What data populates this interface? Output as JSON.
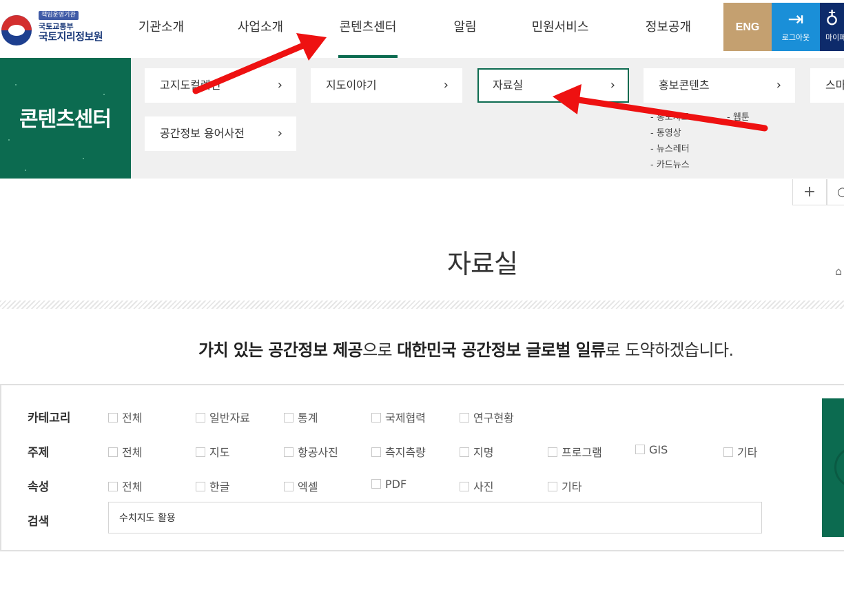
{
  "logo": {
    "badge": "책임운영기관",
    "sub": "국토교통부",
    "main": "국토지리정보원"
  },
  "gnb": [
    {
      "label": "기관소개",
      "active": false
    },
    {
      "label": "사업소개",
      "active": false
    },
    {
      "label": "콘텐츠센터",
      "active": true
    },
    {
      "label": "알림",
      "active": false
    },
    {
      "label": "민원서비스",
      "active": false
    },
    {
      "label": "정보공개",
      "active": false
    }
  ],
  "utility": {
    "eng": "ENG",
    "logout": "로그아웃",
    "mypage": "마이페"
  },
  "submenu": {
    "section_title": "콘텐츠센터",
    "cards": [
      {
        "label": "고지도컬렉션"
      },
      {
        "label": "지도이야기"
      },
      {
        "label": "자료실",
        "selected": true
      },
      {
        "label": "홍보콘텐츠"
      },
      {
        "label": "스마"
      },
      {
        "label": "공간정보 용어사전"
      }
    ],
    "promo_links_left": [
      "- 홍보자료",
      "- 동영상",
      "- 뉴스레터",
      "- 카드뉴스"
    ],
    "promo_links_right": [
      "- 웹툰"
    ]
  },
  "page": {
    "title": "자료실",
    "slogan_parts": [
      {
        "text": "가치 있는 공간정보 제공",
        "bold": true
      },
      {
        "text": "으로 ",
        "bold": false
      },
      {
        "text": "대한민국 공간정보 글로벌 일류",
        "bold": true
      },
      {
        "text": "로 도약하겠습니다.",
        "bold": false
      }
    ]
  },
  "filters": {
    "category": {
      "label": "카테고리",
      "options": [
        "전체",
        "일반자료",
        "통계",
        "국제협력",
        "연구현황"
      ]
    },
    "subject": {
      "label": "주제",
      "options": [
        "전체",
        "지도",
        "항공사진",
        "측지측량",
        "지명",
        "프로그램",
        "GIS",
        "기타"
      ]
    },
    "attribute": {
      "label": "속성",
      "options": [
        "전체",
        "한글",
        "엑셀",
        "PDF",
        "사진",
        "기타"
      ]
    },
    "search": {
      "label": "검색",
      "value": "수치지도 활용"
    }
  },
  "colors": {
    "brand_green": "#0c6b50",
    "eng_gold": "#c4a070",
    "logout_blue": "#1a8fd8",
    "mypage_navy": "#0d2b6b",
    "annotation_arrow": "#ee1111"
  }
}
